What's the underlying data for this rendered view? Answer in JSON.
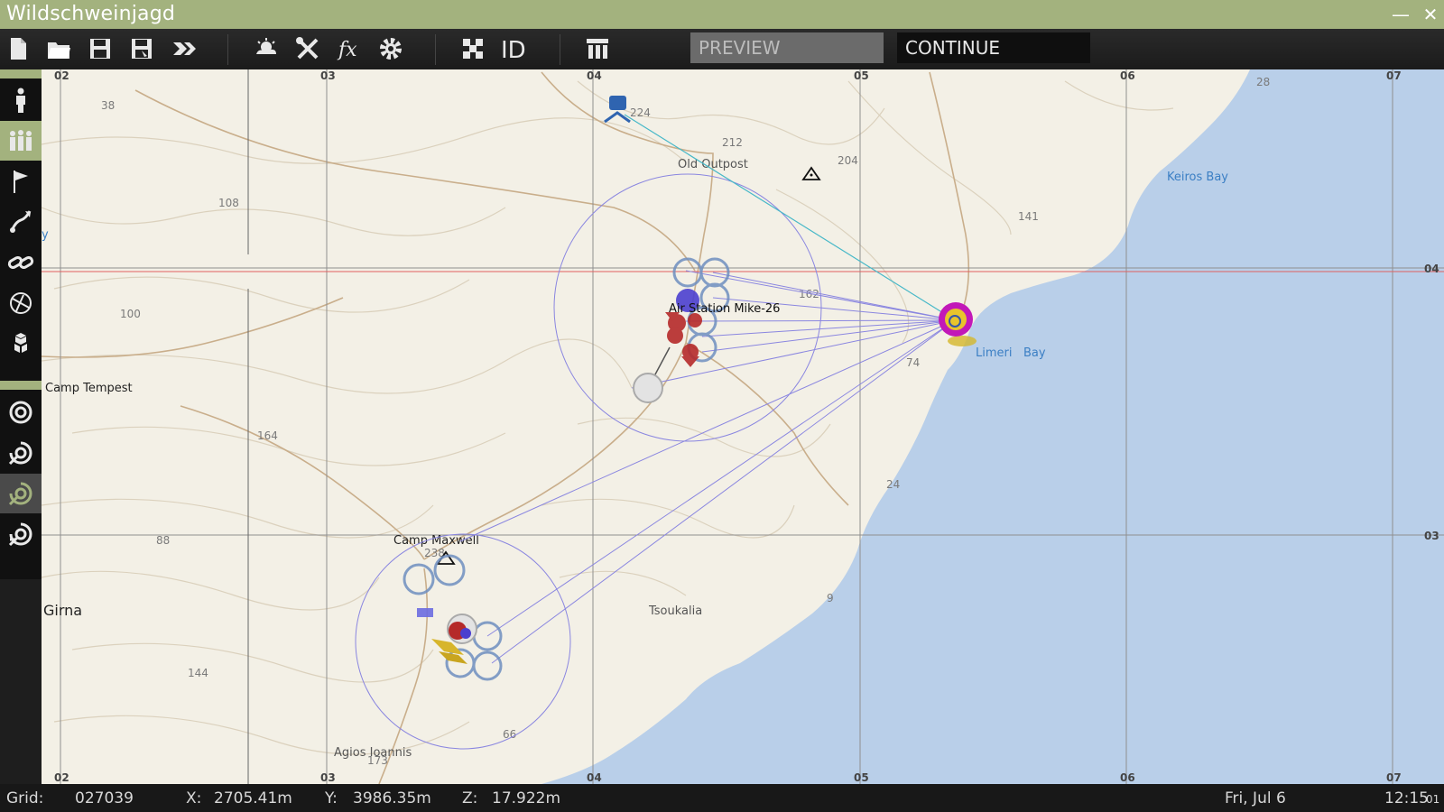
{
  "window": {
    "title": "Wildschweinjagd",
    "minimize_glyph": "—",
    "close_glyph": "✕"
  },
  "toolbar": {
    "buttons": [
      "new-file-icon",
      "open-folder-icon",
      "save-icon",
      "save-as-icon",
      "export-icon",
      "weather-icon",
      "tools-icon",
      "functions-icon",
      "settings-icon",
      "grid-toggle-icon",
      "id-toggle-icon",
      "layout-icon"
    ],
    "id_label": "ID",
    "fx_label": "fx",
    "preview_label": "PREVIEW",
    "continue_label": "CONTINUE"
  },
  "sidebar": {
    "modes": [
      "unit-icon",
      "group-icon",
      "trigger-flag-icon",
      "waypoint-icon",
      "link-icon",
      "marker-icon",
      "module-icon"
    ],
    "tools": [
      "tool-one-icon",
      "tool-two-icon",
      "tool-three-icon",
      "tool-four-icon"
    ]
  },
  "map": {
    "grid_top": [
      "02",
      "03",
      "04",
      "05",
      "06",
      "07"
    ],
    "grid_bottom": [
      "02",
      "03",
      "04",
      "05",
      "06",
      "07"
    ],
    "grid_right": [
      "04",
      "03"
    ],
    "elevations": [
      "38",
      "224",
      "212",
      "204",
      "28",
      "108",
      "141",
      "162",
      "100",
      "74",
      "164",
      "24",
      "88",
      "238",
      "9",
      "144",
      "66",
      "173"
    ],
    "locations": [
      "Old Outpost",
      "Keiros Bay",
      "Camp Tempest",
      "Limeri",
      "Bay",
      "Camp Maxwell",
      "Tsoukalia",
      "Girna",
      "Agios Ioannis",
      "y"
    ],
    "unit_label": "Air Station Mike-26",
    "colors": {
      "land": "#f3f0e6",
      "sea": "#b9cfe9",
      "grid": "#8a8a8a",
      "contour": "#d9d0bd",
      "road": "#c8ae8c",
      "link": "#8a86e0",
      "cyan_link": "#47b8c8",
      "red_line": "#e06060"
    }
  },
  "status": {
    "grid_label": "Grid:",
    "grid_value": "027039",
    "x_label": "X:",
    "x_value": "2705.41m",
    "y_label": "Y:",
    "y_value": "3986.35m",
    "z_label": "Z:",
    "z_value": "17.922m",
    "date": "Fri, Jul 6",
    "time": "12:15",
    "time_suffix": "01"
  }
}
